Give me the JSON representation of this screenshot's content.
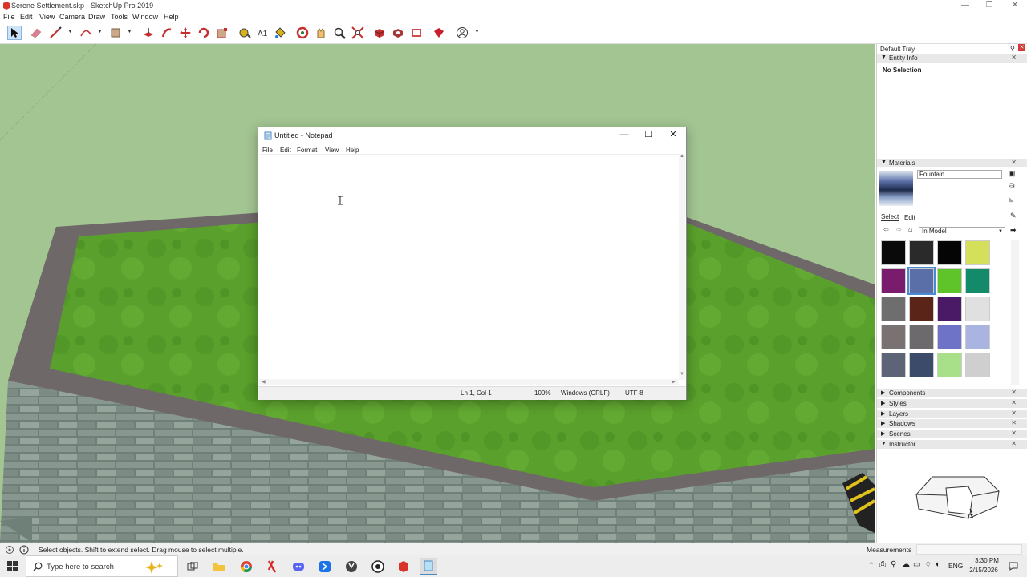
{
  "window": {
    "title": "Serene Settlement.skp - SketchUp Pro 2019"
  },
  "menubar": [
    "File",
    "Edit",
    "View",
    "Camera",
    "Draw",
    "Tools",
    "Window",
    "Help"
  ],
  "toolbar": {
    "tools": [
      "select-tool",
      "eraser-tool",
      "line-tool",
      "arc-tool",
      "rectangle-tool",
      "push-pull-tool",
      "follow-me-tool",
      "move-tool",
      "rotate-tool",
      "scale-tool",
      "tape-measure-tool",
      "text-tool",
      "paint-bucket-tool",
      "orbit-tool",
      "pan-tool",
      "zoom-tool",
      "zoom-extents-tool",
      "3d-warehouse-tool",
      "extension-warehouse-tool",
      "layout-tool",
      "ruby-tool",
      "account-tool"
    ]
  },
  "notepad": {
    "title": "Untitled - Notepad",
    "menu": [
      "File",
      "Edit",
      "Format",
      "View",
      "Help"
    ],
    "content": "",
    "status": {
      "position": "Ln 1, Col 1",
      "zoom": "100%",
      "line_endings": "Windows (CRLF)",
      "encoding": "UTF-8"
    }
  },
  "tray": {
    "title": "Default Tray",
    "entity_info": {
      "label": "Entity Info",
      "value": "No Selection"
    },
    "materials": {
      "label": "Materials",
      "name": "Fountain",
      "tabs": [
        "Select",
        "Edit"
      ],
      "collection": "In Model",
      "swatch_colors": [
        "#0a0a0a",
        "#2a2a2a",
        "#050505",
        "#d4e05a",
        "#7a1c6e",
        "#5a6fa8",
        "#5fc42a",
        "#138a6a",
        "#6e6e6e",
        "#5a2418",
        "#4a1a66",
        "#e0e0e0",
        "#7a7272",
        "#6c6a6c",
        "#6f73c8",
        "#a9b4e0",
        "#5e6478",
        "#3c4b6a",
        "#a8e08a",
        "#cfcfcf"
      ]
    },
    "sections": [
      "Components",
      "Styles",
      "Layers",
      "Shadows",
      "Scenes",
      "Instructor"
    ]
  },
  "statusbar": {
    "hint": "Select objects. Shift to extend select. Drag mouse to select multiple.",
    "measurements_label": "Measurements"
  },
  "taskbar": {
    "search_placeholder": "Type here to search",
    "apps": [
      "task-view",
      "file-explorer",
      "chrome",
      "app-red",
      "discord",
      "app-blue",
      "app-circle",
      "app-github",
      "sketchup",
      "notepad"
    ],
    "language": "ENG",
    "time": "3:30 PM",
    "date": "2/15/2026"
  }
}
